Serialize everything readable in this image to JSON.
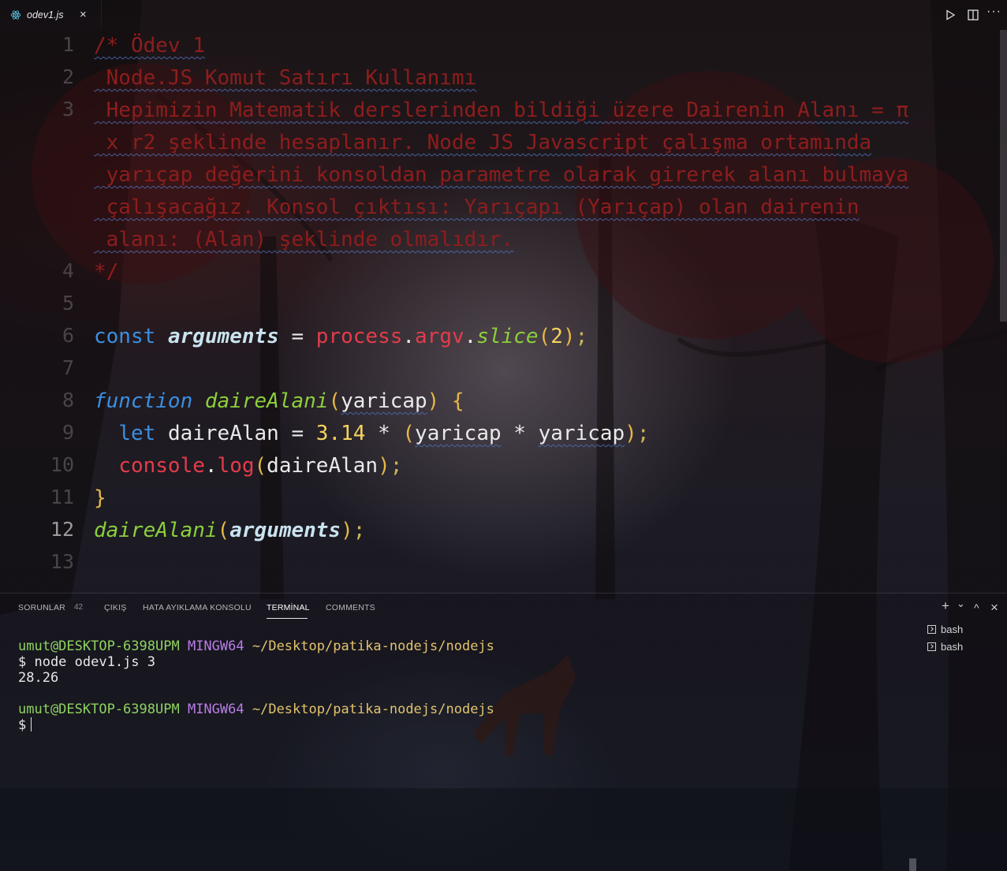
{
  "tab": {
    "filename": "odev1.js",
    "icon": "react-icon",
    "close": "×"
  },
  "toolbar": {
    "run_icon": "play-icon",
    "split_icon": "split-editor-icon",
    "more": "···"
  },
  "editor": {
    "line_numbers": [
      "1",
      "2",
      "3",
      "4",
      "5",
      "6",
      "7",
      "8",
      "9",
      "10",
      "11",
      "12",
      "13"
    ],
    "current_line": "12",
    "comment": [
      "/* Ödev 1",
      " Node.JS Komut Satırı Kullanımı",
      " Hepimizin Matematik derslerinden bildiği üzere Dairenin Alanı = π",
      " x r2 şeklinde hesaplanır. Node JS Javascript çalışma ortamında",
      " yarıçap değerini konsoldan parametre olarak girerek alanı bulmaya",
      " çalışacağız. Konsol çıktısı: Yarıçapı (Yarıçap) olan dairenin",
      " alanı: (Alan) şeklinde olmalıdır.",
      "*/"
    ],
    "tokens": {
      "const": "const",
      "arguments": "arguments",
      "eq": " = ",
      "process": "process",
      "dot": ".",
      "argv": "argv",
      "slice": "slice",
      "lp": "(",
      "two": "2",
      "rp": ")",
      "semi": ";",
      "function": "function",
      "daireAlani": "daireAlani",
      "yaricap": "yaricap",
      "brace_open": " {",
      "let": "let",
      "daireAlan": "daireAlan",
      "pi_approx": "3.14",
      "star": " * ",
      "console": "console",
      "log": "log",
      "brace_close": "}"
    }
  },
  "panel": {
    "tabs": [
      {
        "label": "SORUNLAR",
        "badge": "42"
      },
      {
        "label": "ÇIKIŞ"
      },
      {
        "label": "HATA AYIKLAMA KONSOLU"
      },
      {
        "label": "TERMİNAL",
        "active": true
      },
      {
        "label": "COMMENTS"
      }
    ],
    "actions": {
      "add": "+",
      "dropdown": "⌄",
      "maximize": "^",
      "close": "×"
    },
    "terminal": {
      "user": "umut@DESKTOP-6398UPM",
      "system": "MINGW64",
      "path": "~/Desktop/patika-nodejs/nodejs",
      "command": "$ node odev1.js 3",
      "output": "28.26",
      "prompt": "$"
    },
    "shells": [
      "bash",
      "bash"
    ]
  }
}
